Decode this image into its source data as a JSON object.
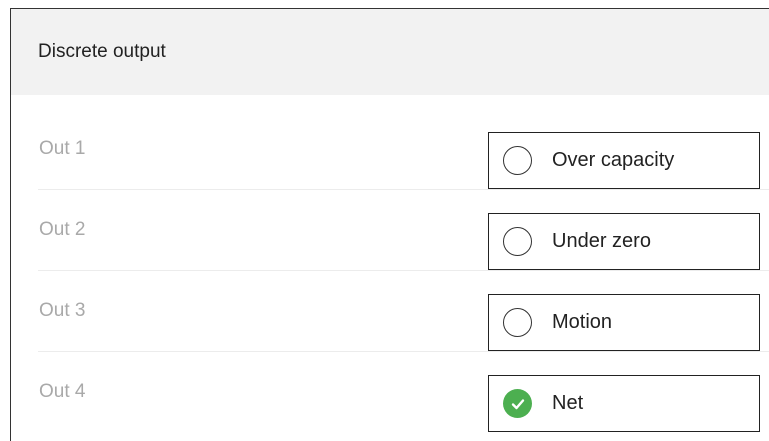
{
  "panel": {
    "title": "Discrete output"
  },
  "outputs": [
    {
      "label": "Out 1",
      "status_text": "Over capacity",
      "active": false,
      "icon": "circle-outline-icon"
    },
    {
      "label": "Out 2",
      "status_text": "Under zero",
      "active": false,
      "icon": "circle-outline-icon"
    },
    {
      "label": "Out 3",
      "status_text": "Motion",
      "active": false,
      "icon": "circle-outline-icon"
    },
    {
      "label": "Out 4",
      "status_text": "Net",
      "active": true,
      "icon": "check-circle-icon"
    }
  ],
  "colors": {
    "active": "#4caf50",
    "header_bg": "#f2f2f2",
    "label": "#a9a9a9"
  }
}
